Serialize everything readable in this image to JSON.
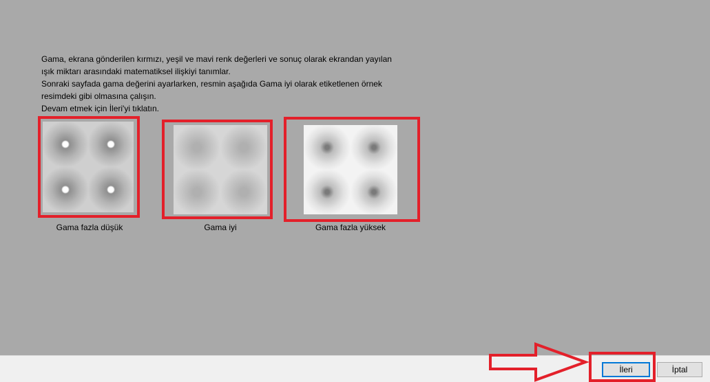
{
  "description": {
    "line1": "Gama, ekrana gönderilen kırmızı, yeşil ve mavi renk değerleri ve sonuç olarak ekrandan yayılan",
    "line2": "ışık miktarı arasındaki matematiksel ilişkiyi tanımlar.",
    "line3": "Sonraki sayfada gama değerini ayarlarken, resmin aşağıda Gama iyi olarak etiketlenen örnek",
    "line4": "resimdeki gibi olmasına çalışın.",
    "line5": "Devam etmek için İleri'yi tıklatın."
  },
  "samples": [
    {
      "label": "Gama fazla düşük"
    },
    {
      "label": "Gama iyi"
    },
    {
      "label": "Gama fazla yüksek"
    }
  ],
  "buttons": {
    "next": "İleri",
    "cancel": "İptal"
  },
  "colors": {
    "highlight": "#e3202a",
    "background": "#a9a9a9",
    "focus": "#0078d7"
  }
}
